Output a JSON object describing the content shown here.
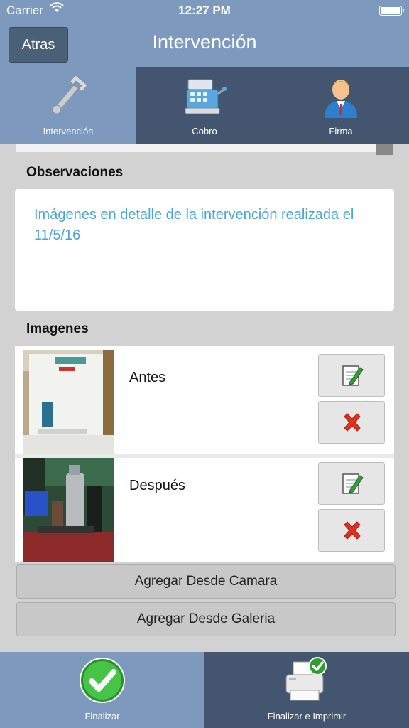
{
  "status_bar": {
    "carrier": "Carrier",
    "time": "12:27 PM"
  },
  "nav": {
    "back_label": "Atras",
    "title": "Intervención"
  },
  "tabs": [
    {
      "label": "Intervención",
      "icon": "wrench-icon",
      "active": true
    },
    {
      "label": "Cobro",
      "icon": "cash-register-icon",
      "active": false
    },
    {
      "label": "Firma",
      "icon": "user-icon",
      "active": false
    }
  ],
  "observaciones": {
    "title": "Observaciones",
    "text": "Imágenes en detalle de la intervención realizada el 11/5/16"
  },
  "imagenes": {
    "title": "Imagenes",
    "items": [
      {
        "caption": "Antes",
        "thumb": "boiler-photo"
      },
      {
        "caption": "Después",
        "thumb": "boiler-room-photo"
      }
    ],
    "edit_icon": "edit-note-icon",
    "delete_icon": "delete-x-icon"
  },
  "buttons": {
    "camera": "Agregar Desde Camara",
    "gallery": "Agregar Desde Galeria"
  },
  "bottom_bar": {
    "finish": "Finalizar",
    "finish_print": "Finalizar e Imprimir"
  },
  "colors": {
    "nav_blue": "#7d99bd",
    "tab_dark": "#44566f",
    "link_blue": "#4aa6d8",
    "delete_red": "#e0301e",
    "check_green": "#3cb83c"
  }
}
